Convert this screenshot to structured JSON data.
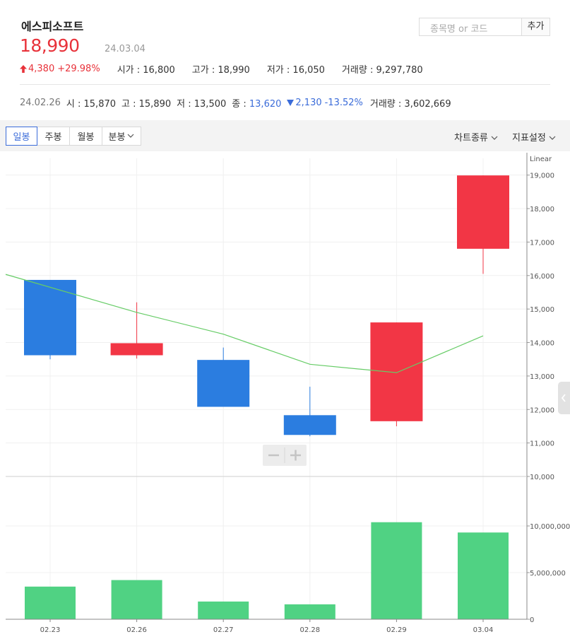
{
  "stock": {
    "name": "에스피소프트",
    "price": "18,990",
    "date": "24.03.04",
    "change": "4,380",
    "change_pct": "+29.98%",
    "open_label": "시가",
    "open": "16,800",
    "high_label": "고가",
    "high": "18,990",
    "low_label": "저가",
    "low": "16,050",
    "volume_label": "거래량",
    "volume": "9,297,780"
  },
  "search": {
    "placeholder": "종목명 or 코드",
    "add_label": "추가"
  },
  "prev": {
    "date": "24.02.26",
    "open_label": "시",
    "open": "15,870",
    "high_label": "고",
    "high": "15,890",
    "low_label": "저",
    "low": "13,500",
    "close_label": "종",
    "close": "13,620",
    "change": "2,130",
    "change_pct": "-13.52%",
    "volume_label": "거래량",
    "volume": "3,602,669"
  },
  "tabs": [
    "일봉",
    "주봉",
    "월봉",
    "분봉"
  ],
  "active_tab": "일봉",
  "tools": {
    "chart_type": "차트종류",
    "indicator": "지표설정"
  },
  "colors": {
    "up": "#f23645",
    "down": "#2b7de0",
    "volume": "#50d283",
    "ma": "#66cc66",
    "accent": "#3b6cd9"
  },
  "chart_data": {
    "type": "candlestick",
    "scale": "Linear",
    "categories": [
      "02.23",
      "02.26",
      "02.27",
      "02.28",
      "02.29",
      "03.04"
    ],
    "ohlc": [
      {
        "open": 15870,
        "high": 15870,
        "low": 13500,
        "close": 13620
      },
      {
        "open": 13620,
        "high": 15200,
        "low": 13520,
        "close": 13980
      },
      {
        "open": 13480,
        "high": 13850,
        "low": 12080,
        "close": 12080
      },
      {
        "open": 11830,
        "high": 12680,
        "low": 11200,
        "close": 11240
      },
      {
        "open": 11650,
        "high": 14600,
        "low": 11500,
        "close": 14600
      },
      {
        "open": 16800,
        "high": 18990,
        "low": 16050,
        "close": 18990
      }
    ],
    "moving_average": [
      15650,
      14900,
      14250,
      13350,
      13100,
      14200
    ],
    "volume": [
      3500000,
      4200000,
      1900000,
      1600000,
      10400000,
      9297780
    ],
    "price_axis": {
      "ylim": [
        10000,
        19500
      ],
      "ticks": [
        "10,000",
        "11,000",
        "12,000",
        "13,000",
        "14,000",
        "15,000",
        "16,000",
        "17,000",
        "18,000",
        "19,000"
      ]
    },
    "volume_axis": {
      "ylim": [
        0,
        15000000
      ],
      "ticks": [
        "0",
        "5,000,000",
        "10,000,000"
      ]
    }
  }
}
